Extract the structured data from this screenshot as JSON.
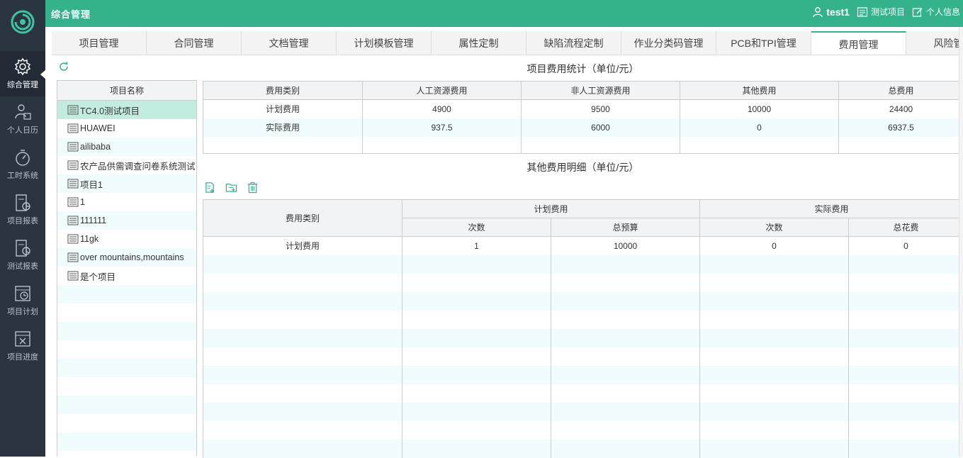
{
  "app": {
    "section_title": "综合管理",
    "user": "test1",
    "top_links": [
      "测试项目",
      "个人信息"
    ]
  },
  "sidebar": {
    "items": [
      {
        "label": "综合管理",
        "icon": "gear-icon",
        "active": true
      },
      {
        "label": "个人日历",
        "icon": "user-calendar-icon"
      },
      {
        "label": "工时系统",
        "icon": "stopwatch-icon"
      },
      {
        "label": "项目报表",
        "icon": "report-chart-icon"
      },
      {
        "label": "测试报表",
        "icon": "report-pie-icon"
      },
      {
        "label": "项目计划",
        "icon": "plan-clock-icon"
      },
      {
        "label": "项目进度",
        "icon": "progress-icon"
      }
    ]
  },
  "tabs": [
    "项目管理",
    "合同管理",
    "文档管理",
    "计划模板管理",
    "属性定制",
    "缺陷流程定制",
    "作业分类码管理",
    "PCB和TPI管理",
    "费用管理",
    "风险管理"
  ],
  "active_tab": "费用管理",
  "projects": {
    "header": "项目名称",
    "items": [
      "TC4.0测试项目",
      "HUAWEI",
      "ailibaba",
      "农产品供需调查问卷系统测试",
      "项目1",
      "1",
      "111111",
      "11gk",
      "over mountains,mountains",
      "是个项目"
    ],
    "selected": "TC4.0测试项目"
  },
  "stats": {
    "title": "项目费用统计（单位/元）",
    "columns": [
      "费用类别",
      "人工资源费用",
      "非人工资源费用",
      "其他费用",
      "总费用"
    ],
    "rows": [
      [
        "计划费用",
        "4900",
        "9500",
        "10000",
        "24400"
      ],
      [
        "实际费用",
        "937.5",
        "6000",
        "0",
        "6937.5"
      ]
    ]
  },
  "detail": {
    "title": "其他费用明细（单位/元）",
    "category_header": "费用类别",
    "group_planned": "计划费用",
    "group_actual": "实际费用",
    "sub_count": "次数",
    "sub_budget": "总预算",
    "sub_spent": "总花费",
    "rows": [
      [
        "计划费用",
        "1",
        "10000",
        "0",
        "0"
      ]
    ]
  },
  "colors": {
    "accent": "#33b28c",
    "sidebar_bg": "#2b3441",
    "selected_row": "#c3ece0"
  }
}
